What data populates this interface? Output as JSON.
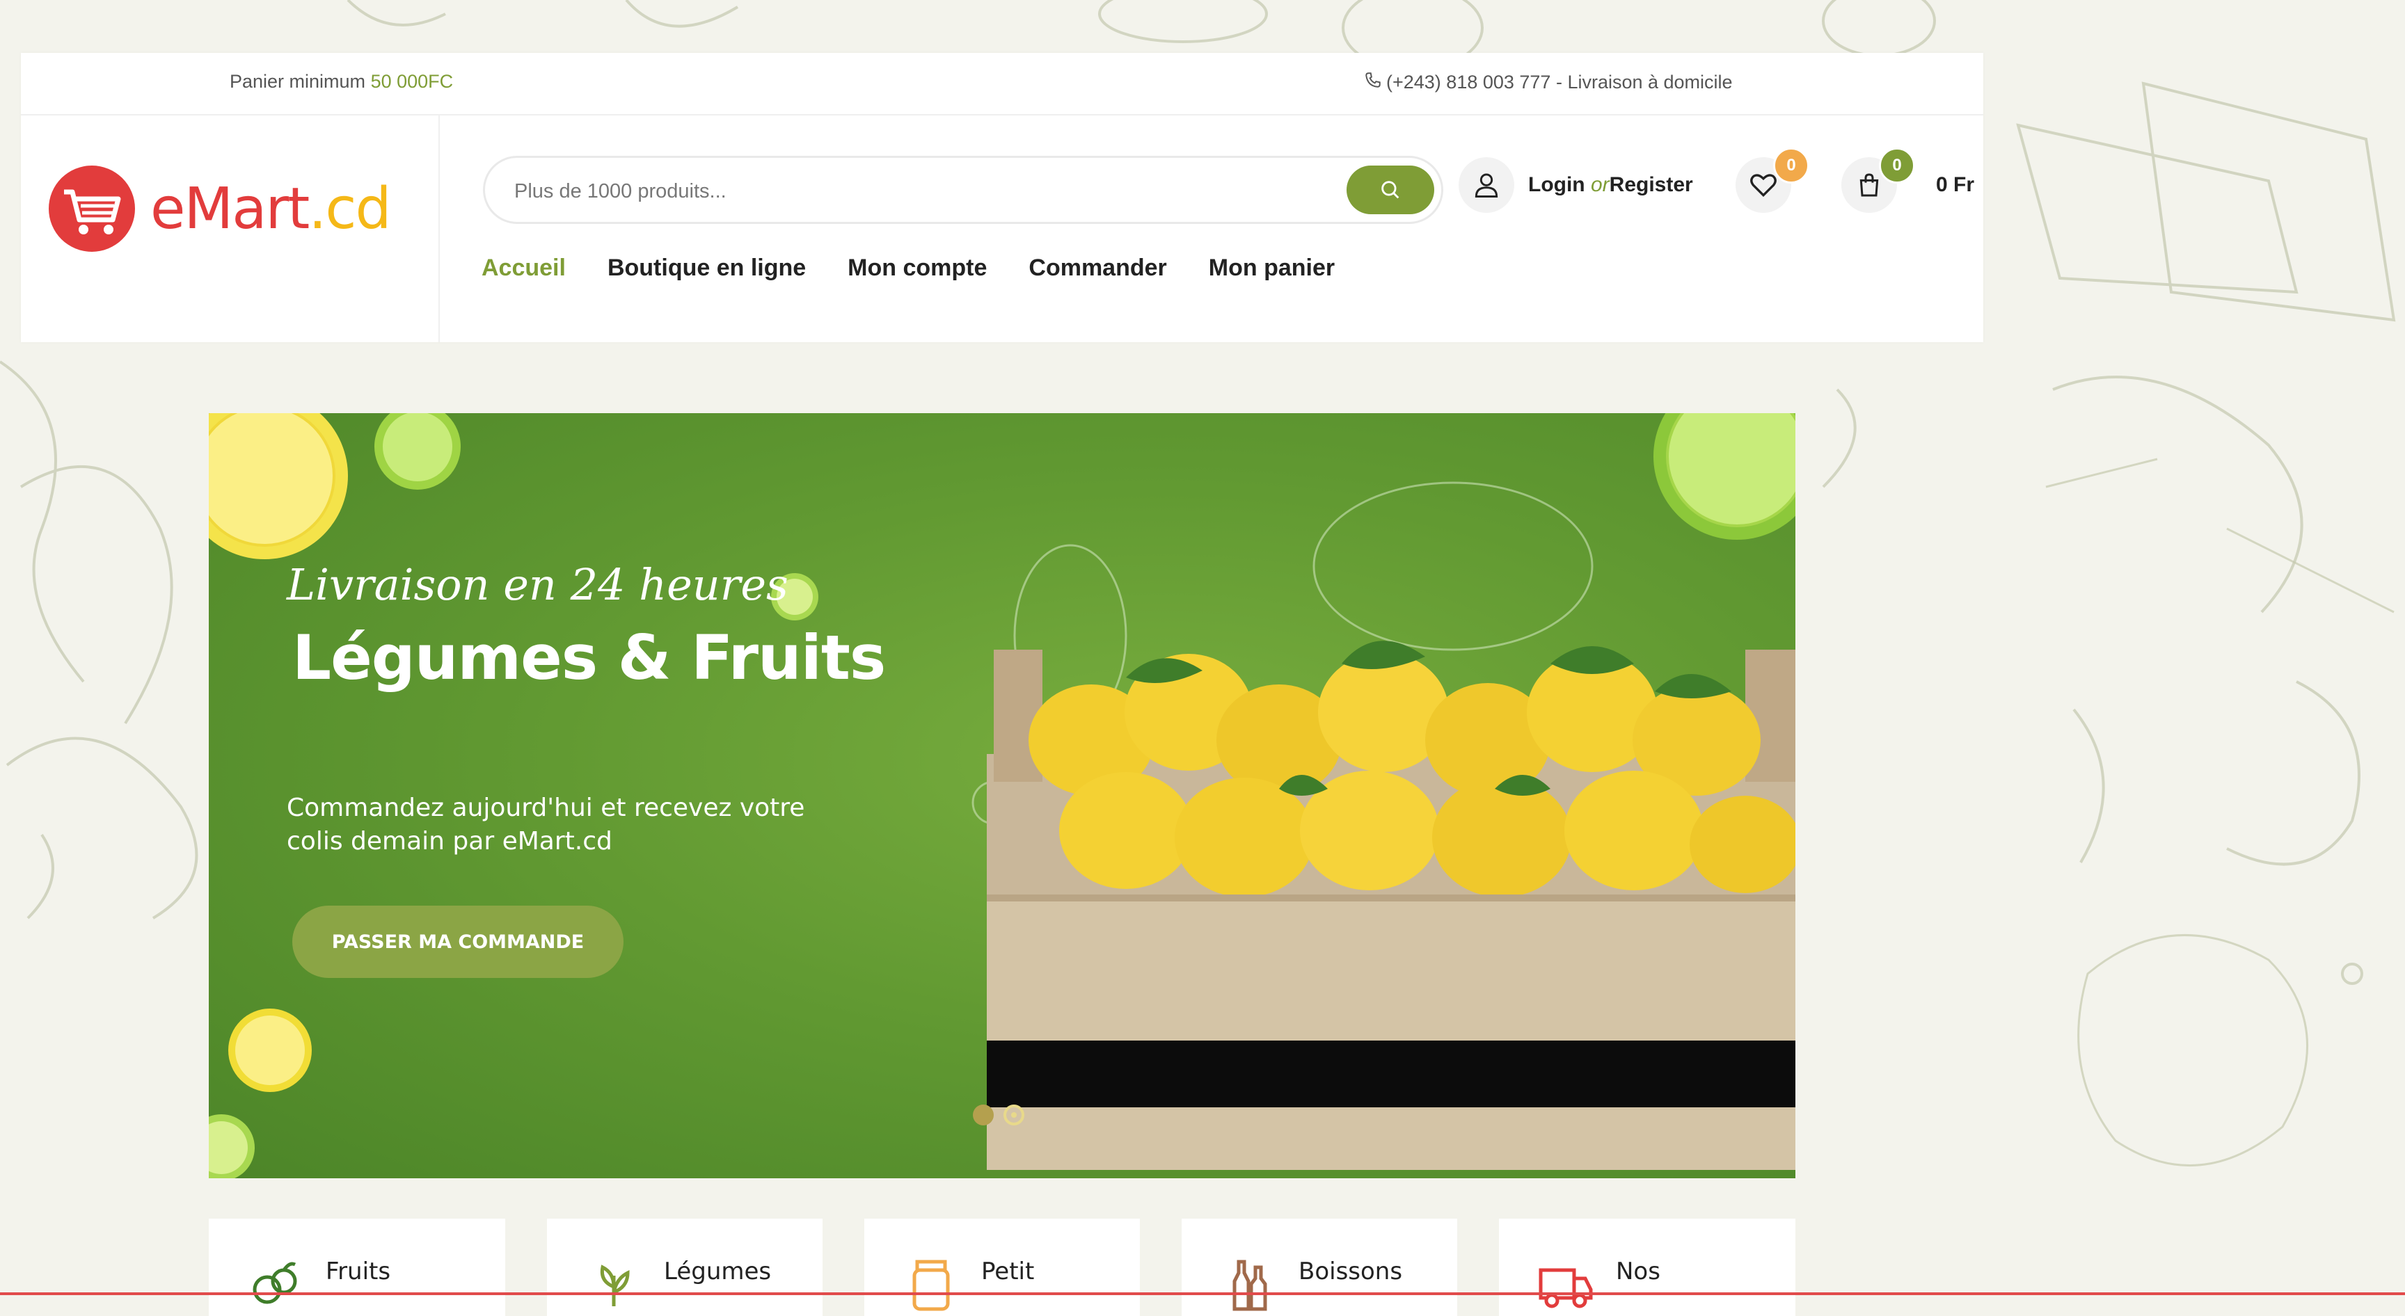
{
  "topbar": {
    "min_cart_label": "Panier minimum",
    "min_cart_value": "50 000FC",
    "contact": "(+243) 818 003 777 - Livraison à domicile"
  },
  "logo": {
    "part1": "eMart",
    "part2": ".cd"
  },
  "search": {
    "placeholder": "Plus de 1000 produits..."
  },
  "nav": [
    {
      "label": "Accueil",
      "active": true
    },
    {
      "label": "Boutique en ligne"
    },
    {
      "label": "Mon compte"
    },
    {
      "label": "Commander"
    },
    {
      "label": "Mon panier"
    }
  ],
  "account": {
    "login": "Login",
    "or": "or",
    "register": "Register"
  },
  "wishlist": {
    "count": "0"
  },
  "cart": {
    "count": "0",
    "total": "0 Fr"
  },
  "hero": {
    "script": "Livraison en 24 heures",
    "title": "Légumes & Fruits",
    "desc": "Commandez aujourd'hui et recevez votre colis demain par eMart.cd",
    "cta": "PASSER MA COMMANDE",
    "slides": 2,
    "active_slide": 2
  },
  "categories": [
    {
      "label": "Fruits",
      "icon": "fruits-icon"
    },
    {
      "label": "Légumes",
      "icon": "leaf-icon"
    },
    {
      "label": "Petit",
      "icon": "jar-icon"
    },
    {
      "label": "Boissons",
      "icon": "bottles-icon"
    },
    {
      "label": "Nos",
      "icon": "truck-icon"
    }
  ],
  "colors": {
    "accent": "#7f9d36",
    "brand_red": "#e23c3c",
    "brand_yellow": "#f5b817",
    "badge_orange": "#f2a94a"
  }
}
